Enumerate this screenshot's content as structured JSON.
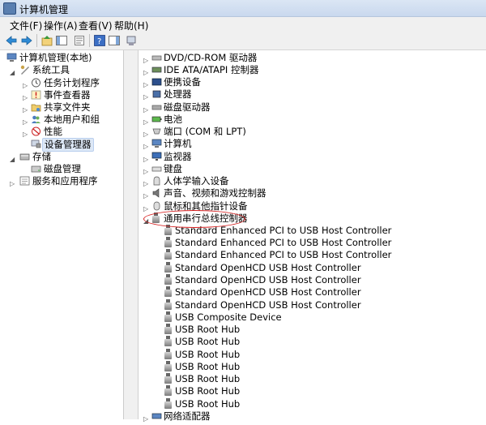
{
  "window": {
    "title": "计算机管理"
  },
  "menu": [
    "文件(F)",
    "操作(A)",
    "查看(V)",
    "帮助(H)"
  ],
  "toolbar": {
    "buttons": [
      "back-icon",
      "forward-icon",
      "up-icon",
      "show-hide-tree-icon",
      "properties-icon",
      "help-icon",
      "view-icon",
      "update-driver-icon"
    ]
  },
  "tree": {
    "root": "计算机管理(本地)",
    "system_tools": "系统工具",
    "task_scheduler": "任务计划程序",
    "event_viewer": "事件查看器",
    "shared_folders": "共享文件夹",
    "local_users": "本地用户和组",
    "performance": "性能",
    "device_manager": "设备管理器",
    "storage": "存储",
    "disk_management": "磁盘管理",
    "services": "服务和应用程序"
  },
  "devices": {
    "categories_before": [
      "DVD/CD-ROM 驱动器",
      "IDE ATA/ATAPI 控制器",
      "便携设备",
      "处理器",
      "磁盘驱动器",
      "电池",
      "端口 (COM 和 LPT)",
      "计算机",
      "监视器",
      "键盘",
      "人体学输入设备",
      "声音、视频和游戏控制器",
      "鼠标和其他指针设备"
    ],
    "usb_category": "通用串行总线控制器",
    "usb_children": [
      "Standard Enhanced PCI to USB Host Controller",
      "Standard Enhanced PCI to USB Host Controller",
      "Standard Enhanced PCI to USB Host Controller",
      "Standard OpenHCD USB Host Controller",
      "Standard OpenHCD USB Host Controller",
      "Standard OpenHCD USB Host Controller",
      "Standard OpenHCD USB Host Controller",
      "USB Composite Device",
      "USB Root Hub",
      "USB Root Hub",
      "USB Root Hub",
      "USB Root Hub",
      "USB Root Hub",
      "USB Root Hub",
      "USB Root Hub"
    ],
    "category_after": "网络适配器"
  }
}
